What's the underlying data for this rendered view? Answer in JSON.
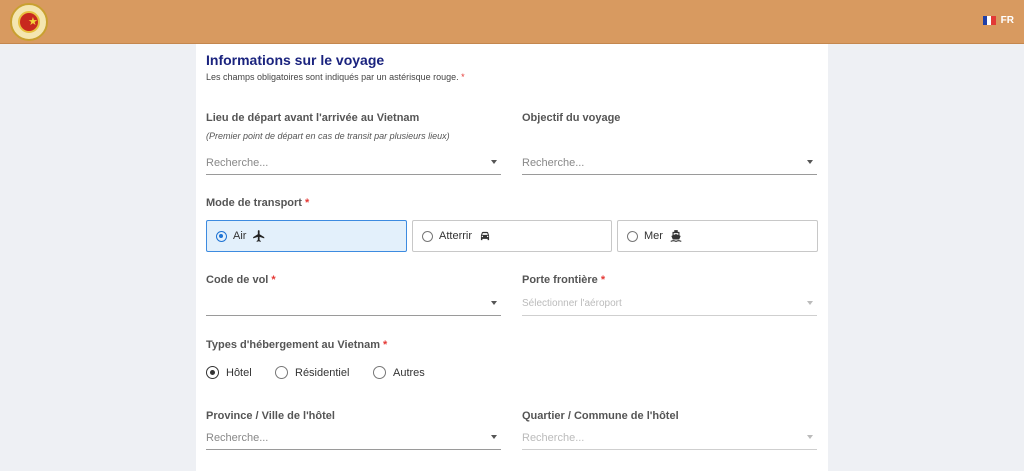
{
  "header": {
    "language_code": "FR",
    "logo_name": "emblem-logo"
  },
  "form": {
    "title": "Informations sur le voyage",
    "note": "Les champs obligatoires sont indiqués par un astérisque rouge.",
    "required_mark": "*",
    "departure": {
      "label": "Lieu de départ avant l'arrivée au Vietnam",
      "help": "(Premier point de départ en cas de transit par plusieurs lieux)",
      "placeholder": "Recherche..."
    },
    "purpose": {
      "label": "Objectif du voyage",
      "placeholder": "Recherche..."
    },
    "transport": {
      "label": "Mode de transport",
      "options": [
        {
          "label": "Air",
          "icon": "airplane-icon",
          "selected": true
        },
        {
          "label": "Atterrir",
          "icon": "car-icon",
          "selected": false
        },
        {
          "label": "Mer",
          "icon": "ship-icon",
          "selected": false
        }
      ]
    },
    "flight_code": {
      "label": "Code de vol",
      "value": ""
    },
    "border_gate": {
      "label": "Porte frontière",
      "placeholder": "Sélectionner l'aéroport"
    },
    "accommodation": {
      "label": "Types d'hébergement au Vietnam",
      "options": [
        {
          "label": "Hôtel",
          "selected": true
        },
        {
          "label": "Résidentiel",
          "selected": false
        },
        {
          "label": "Autres",
          "selected": false
        }
      ]
    },
    "hotel_province": {
      "label": "Province / Ville de l'hôtel",
      "placeholder": "Recherche..."
    },
    "hotel_district": {
      "label": "Quartier / Commune de l'hôtel",
      "placeholder": "Recherche..."
    }
  },
  "colors": {
    "header": "#d89a60",
    "title": "#1a237e",
    "required": "#e53935",
    "accent": "#1e73d4"
  }
}
